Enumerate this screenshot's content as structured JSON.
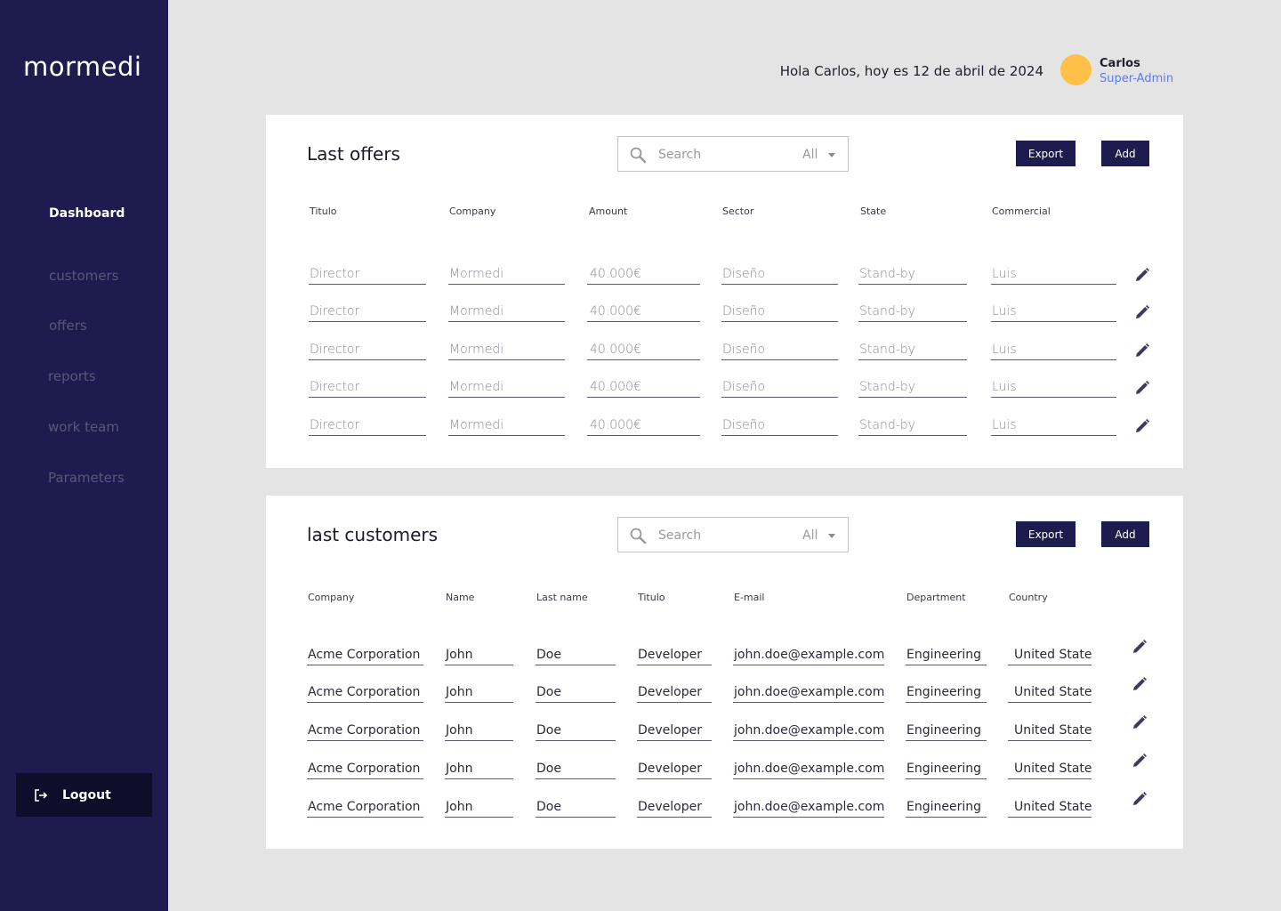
{
  "sidebar": {
    "logo": "mormedi",
    "items": [
      {
        "label": "Dashboard",
        "active": true
      },
      {
        "label": "customers",
        "active": false
      },
      {
        "label": "offers",
        "active": false
      },
      {
        "label": "reports",
        "active": false
      },
      {
        "label": "work team",
        "active": false
      },
      {
        "label": "Parameters",
        "active": false
      }
    ],
    "logout_label": "Logout"
  },
  "header": {
    "greeting": "Hola Carlos, hoy es 12 de abril de 2024",
    "user_name": "Carlos",
    "user_role": "Super-Admin"
  },
  "offers": {
    "title": "Last offers",
    "search_placeholder": "Search",
    "filter_value": "All",
    "export_label": "Export",
    "add_label": "Add",
    "columns": [
      "Titulo",
      "Company",
      "Amount",
      "Sector",
      "State",
      "Commercial"
    ],
    "rows": [
      [
        "Director",
        "Mormedi",
        "40.000€",
        "Diseño",
        "Stand-by",
        "Luis"
      ],
      [
        "Director",
        "Mormedi",
        "40.000€",
        "Diseño",
        "Stand-by",
        "Luis"
      ],
      [
        "Director",
        "Mormedi",
        "40.000€",
        "Diseño",
        "Stand-by",
        "Luis"
      ],
      [
        "Director",
        "Mormedi",
        "40.000€",
        "Diseño",
        "Stand-by",
        "Luis"
      ],
      [
        "Director",
        "Mormedi",
        "40.000€",
        "Diseño",
        "Stand-by",
        "Luis"
      ]
    ]
  },
  "customers": {
    "title": "last customers",
    "search_placeholder": "Search",
    "filter_value": "All",
    "export_label": "Export",
    "add_label": "Add",
    "columns": [
      "Company",
      "Name",
      "Last name",
      "Titulo",
      "E-mail",
      "Department",
      "Country"
    ],
    "rows": [
      [
        "Acme Corporation",
        "John",
        "Doe",
        "Developer",
        "john.doe@example.com",
        "Engineering",
        "United States"
      ],
      [
        "Acme Corporation",
        "John",
        "Doe",
        "Developer",
        "john.doe@example.com",
        "Engineering",
        "United States"
      ],
      [
        "Acme Corporation",
        "John",
        "Doe",
        "Developer",
        "john.doe@example.com",
        "Engineering",
        "United States"
      ],
      [
        "Acme Corporation",
        "John",
        "Doe",
        "Developer",
        "john.doe@example.com",
        "Engineering",
        "United States"
      ],
      [
        "Acme Corporation",
        "John",
        "Doe",
        "Developer",
        "john.doe@example.com",
        "Engineering",
        "United States"
      ]
    ]
  },
  "icons": {
    "search": "search-icon",
    "edit": "pencil-icon",
    "logout": "logout-icon",
    "dropdown": "caret-down-icon"
  },
  "colors": {
    "sidebar_bg": "#1e1b4e",
    "page_bg": "#e4e4e4",
    "accent": "#5b7cf5",
    "avatar": "#ffc04a",
    "button_bg": "#1e1b4e"
  }
}
